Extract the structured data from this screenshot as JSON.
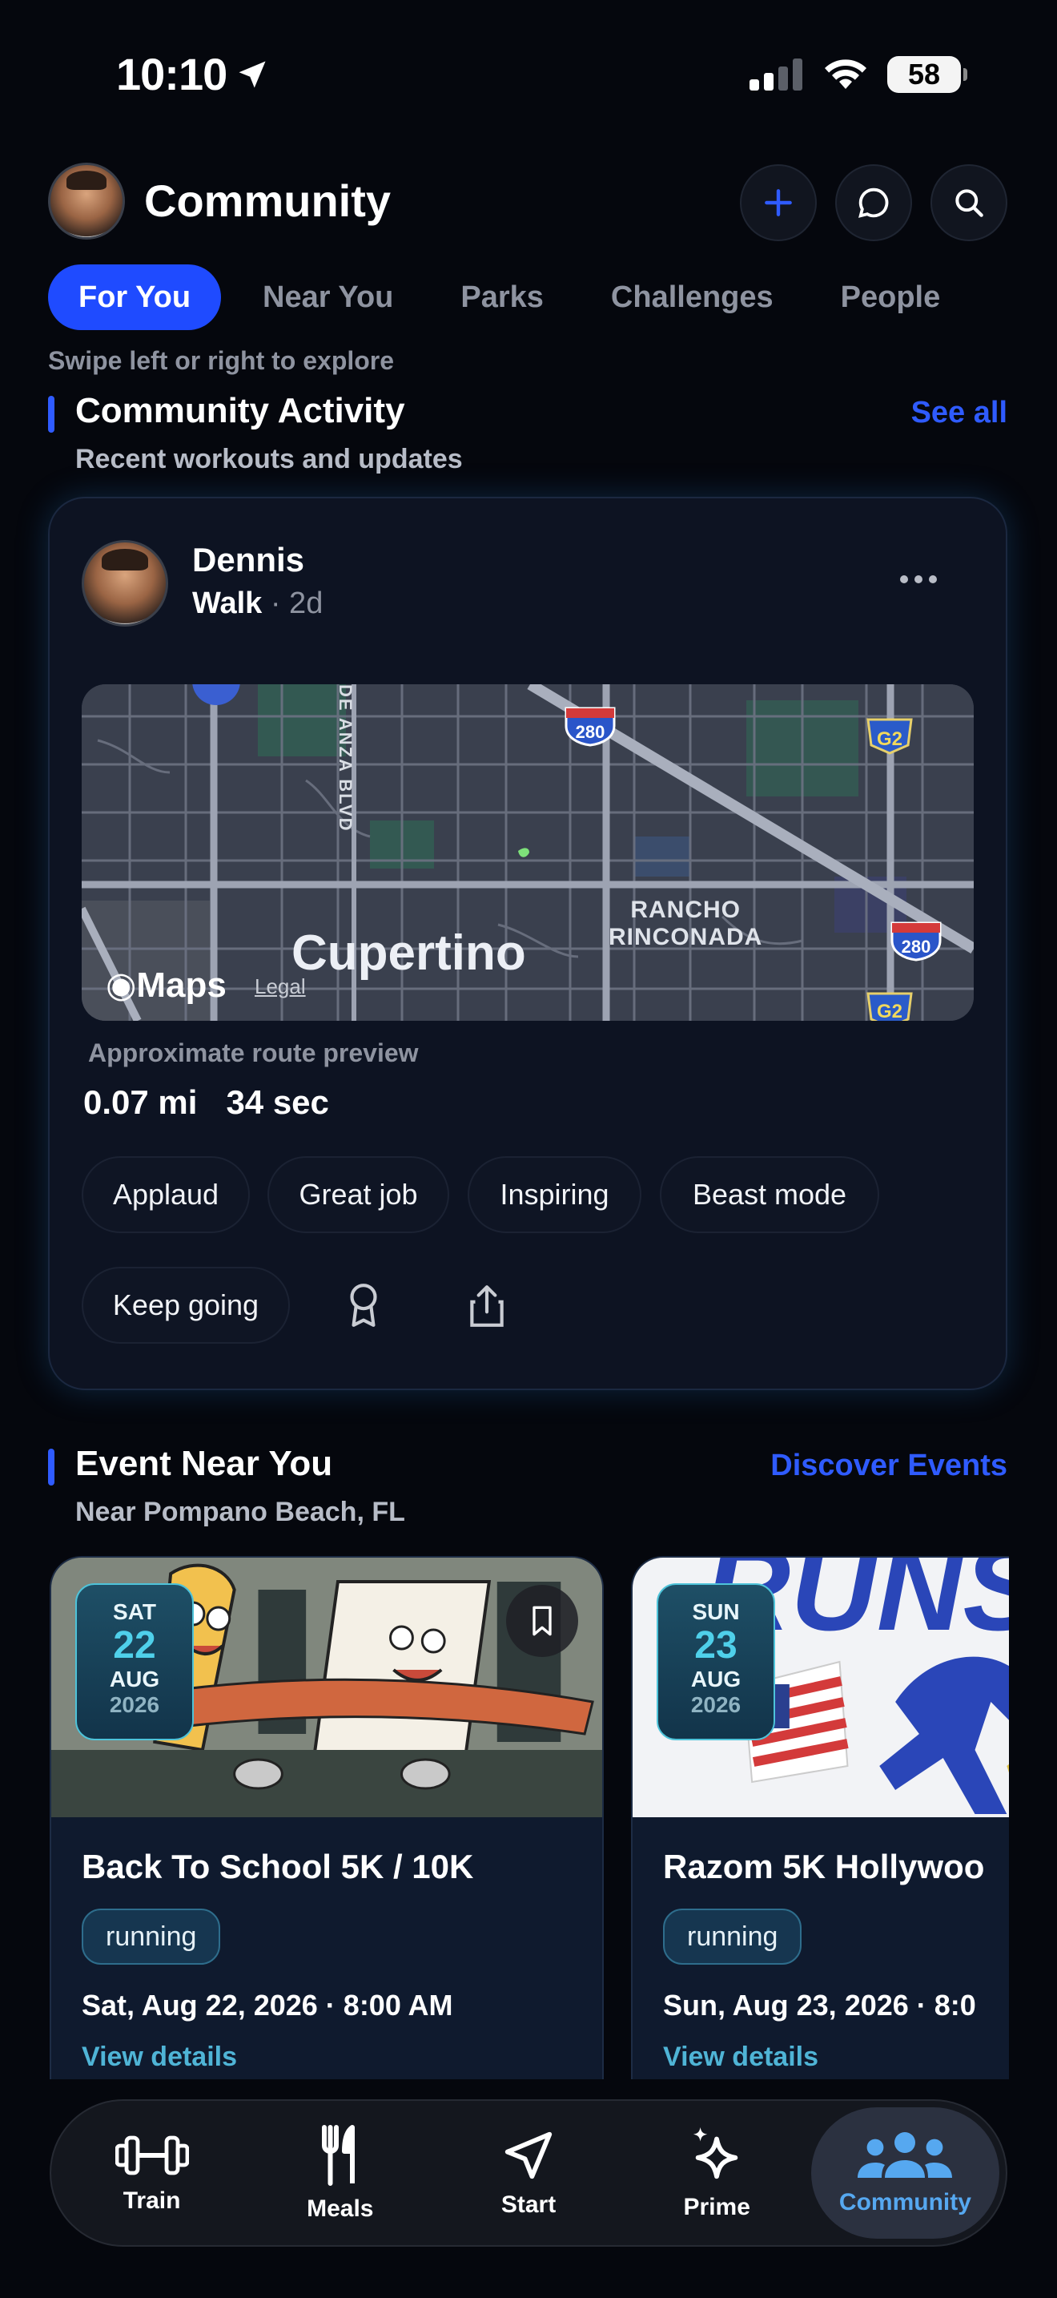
{
  "status_bar": {
    "time": "10:10",
    "battery": "58"
  },
  "header": {
    "title": "Community"
  },
  "tabs": [
    {
      "label": "For You",
      "active": true
    },
    {
      "label": "Near You"
    },
    {
      "label": "Parks"
    },
    {
      "label": "Challenges"
    },
    {
      "label": "People"
    }
  ],
  "swipe_hint": "Swipe left or right to explore",
  "activity_section": {
    "title": "Community Activity",
    "subtitle": "Recent workouts and updates",
    "link": "See all"
  },
  "post": {
    "user": "Dennis",
    "activity": "Walk",
    "age": "· 2d",
    "map": {
      "city": "Cupertino",
      "area_line1": "RANCHO",
      "area_line2": "RINCONADA",
      "road": "DE ANZA BLVD",
      "shield_1": "280",
      "shield_2": "280",
      "shield_3": "G2",
      "shield_4": "G2",
      "logo": "Maps",
      "legal": "Legal"
    },
    "route_caption": "Approximate route preview",
    "distance": "0.07 mi",
    "duration": "34 sec",
    "reactions": [
      "Applaud",
      "Great job",
      "Inspiring",
      "Beast mode",
      "Keep going"
    ]
  },
  "events_section": {
    "title": "Event Near You",
    "subtitle": "Near Pompano Beach, FL",
    "link": "Discover Events"
  },
  "events": [
    {
      "dow": "SAT",
      "day": "22",
      "month": "AUG",
      "year": "2026",
      "title": "Back To School 5K / 10K",
      "tag": "running",
      "datetime": "Sat, Aug 22, 2026 · 8:00 AM",
      "link": "View details"
    },
    {
      "dow": "SUN",
      "day": "23",
      "month": "AUG",
      "year": "2026",
      "title": "Razom 5K Hollywoo",
      "tag": "running",
      "datetime": "Sun, Aug 23, 2026 · 8:0",
      "link": "View details",
      "banner_text": "RUNS"
    }
  ],
  "bottom_nav": [
    {
      "label": "Train",
      "icon": "dumbbell-icon"
    },
    {
      "label": "Meals",
      "icon": "fork-knife-icon"
    },
    {
      "label": "Start",
      "icon": "location-arrow-icon"
    },
    {
      "label": "Prime",
      "icon": "sparkles-icon"
    },
    {
      "label": "Community",
      "icon": "people-icon",
      "active": true
    }
  ],
  "colors": {
    "accent": "#1f4bff",
    "link": "#2f5bff",
    "teal": "#4fb4d6",
    "background": "#05070d"
  }
}
